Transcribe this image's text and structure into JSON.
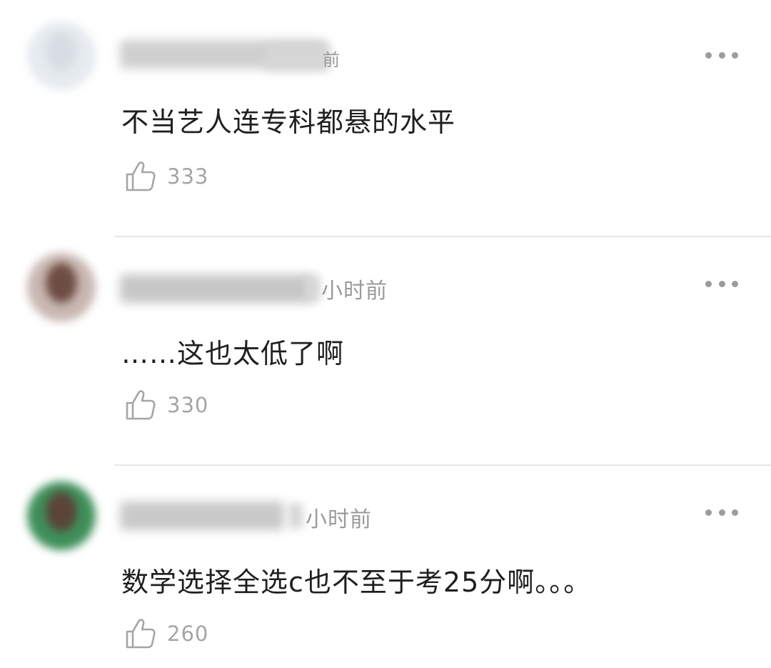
{
  "comments": [
    {
      "time": "前",
      "text": "不当艺人连专科都悬的水平",
      "likes": "333",
      "avatar_colors": [
        "#e6ebef",
        "#d7dde3"
      ],
      "username_color": "#cfcfcf"
    },
    {
      "time": "小时前",
      "text": "……这也太低了啊",
      "likes": "330",
      "avatar_colors": [
        "#c9b7b2",
        "#6e4d44"
      ],
      "username_color": "#c7c7c7"
    },
    {
      "time": "小时前",
      "text": "数学选择全选c也不至于考25分啊。。。",
      "likes": "260",
      "avatar_colors": [
        "#3f8f5a",
        "#5a4538"
      ],
      "username_color": "#c9c9c9"
    }
  ],
  "icons": {
    "like": "thumbs-up-icon",
    "more": "more-dots-icon"
  },
  "colors": {
    "text": "#1f1f1f",
    "muted": "#9a9a9a",
    "divider": "#e6e6e6"
  }
}
